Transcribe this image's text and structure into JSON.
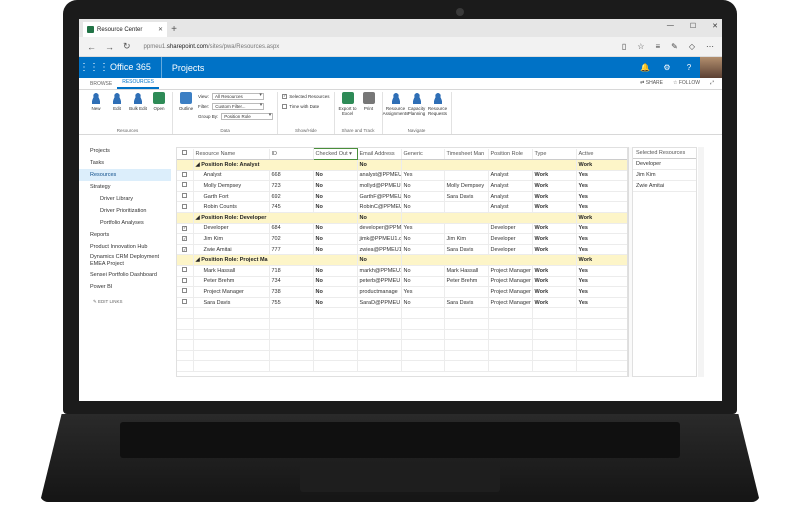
{
  "browser": {
    "tab_title": "Resource Center",
    "new_tab": "+",
    "url_prefix": "ppmeu1.",
    "url_host": "sharepoint.com",
    "url_path": "/sites/pwa/Resources.aspx",
    "win_min": "—",
    "win_max": "☐",
    "win_close": "✕",
    "back": "←",
    "forward": "→",
    "refresh": "↻",
    "close_tab": "✕"
  },
  "suite": {
    "brand": "Office 365",
    "app": "Projects",
    "waffle": "⋮⋮⋮"
  },
  "ribbon": {
    "tabs": [
      "BROWSE",
      "RESOURCES"
    ],
    "share": "SHARE",
    "follow": "FOLLOW",
    "groups": {
      "resources": "Resources",
      "data": "Data",
      "show_hide": "Show/Hide",
      "share_track": "Share and Track",
      "navigate": "Navigate"
    },
    "buttons": {
      "new": "New",
      "edit": "Edit",
      "bulk_edit": "Bulk Edit",
      "open": "Open",
      "outline": "Outline",
      "export": "Export to Excel",
      "print": "Print",
      "assignments": "Resource Assignments",
      "capacity": "Capacity Planning",
      "requests": "Resource Requests"
    },
    "view_label": "View:",
    "view_value": "All Resources",
    "filter_label": "Filter:",
    "filter_value": "Custom Filter...",
    "groupby_label": "Group By:",
    "groupby_value": "Position Role",
    "selected_resources": "Selected Resources",
    "time_with_date": "Time with Date"
  },
  "nav": {
    "items": [
      "Projects",
      "Tasks",
      "Resources",
      "Strategy",
      "Driver Library",
      "Driver Prioritization",
      "Portfolio Analyses",
      "Reports",
      "Product Innovation Hub",
      "Dynamics CRM Deployment EMEA Project",
      "Sensei Portfolio Dashboard",
      "Power BI"
    ],
    "edit_links": "EDIT LINKS"
  },
  "grid": {
    "columns": [
      "Resource Name",
      "ID",
      "Checked Out",
      "Email Address",
      "Generic",
      "Timesheet Man",
      "Position Role",
      "Type",
      "Active"
    ],
    "rows": [
      {
        "kind": "group",
        "name": "Position Role: Analyst",
        "checked_out": "No",
        "type": "Work",
        "active": "Yes"
      },
      {
        "kind": "row",
        "checked": false,
        "name": "Analyst",
        "id": "668",
        "checked_out": "No",
        "email": "analyst@PPMEU",
        "generic": "Yes",
        "timesheet": "",
        "role": "Analyst",
        "type": "Work",
        "active": "Yes"
      },
      {
        "kind": "row",
        "checked": false,
        "name": "Molly Dempsey",
        "id": "723",
        "checked_out": "No",
        "email": "mollyd@PPMEU",
        "generic": "No",
        "timesheet": "Molly Dempsey",
        "role": "Analyst",
        "type": "Work",
        "active": "Yes"
      },
      {
        "kind": "row",
        "checked": false,
        "name": "Garth Fort",
        "id": "692",
        "checked_out": "No",
        "email": "GarthF@PPMEU",
        "generic": "No",
        "timesheet": "Sara Davis",
        "role": "Analyst",
        "type": "Work",
        "active": "Yes"
      },
      {
        "kind": "row",
        "checked": false,
        "name": "Robin Counts",
        "id": "745",
        "checked_out": "No",
        "email": "RobinC@PPMEU",
        "generic": "No",
        "timesheet": "",
        "role": "Analyst",
        "type": "Work",
        "active": "Yes"
      },
      {
        "kind": "group",
        "name": "Position Role: Developer",
        "checked_out": "No",
        "type": "Work",
        "active": "Yes"
      },
      {
        "kind": "row",
        "checked": true,
        "name": "Developer",
        "id": "684",
        "checked_out": "No",
        "email": "developer@PPM",
        "generic": "Yes",
        "timesheet": "",
        "role": "Developer",
        "type": "Work",
        "active": "Yes"
      },
      {
        "kind": "row",
        "checked": true,
        "name": "Jim Kim",
        "id": "702",
        "checked_out": "No",
        "email": "jimk@PPMEU1.o",
        "generic": "No",
        "timesheet": "Jim Kim",
        "role": "Developer",
        "type": "Work",
        "active": "Yes"
      },
      {
        "kind": "row",
        "checked": true,
        "name": "Zwie Amitai",
        "id": "777",
        "checked_out": "No",
        "email": "zwiea@PPMEU1",
        "generic": "No",
        "timesheet": "Sara Davis",
        "role": "Developer",
        "type": "Work",
        "active": "Yes"
      },
      {
        "kind": "group",
        "name": "Position Role: Project Ma",
        "checked_out": "No",
        "type": "Work",
        "active": "Yes"
      },
      {
        "kind": "row",
        "checked": false,
        "name": "Mark Hassall",
        "id": "718",
        "checked_out": "No",
        "email": "markh@PPMEU1",
        "generic": "No",
        "timesheet": "Mark Hassall",
        "role": "Project Manager",
        "type": "Work",
        "active": "Yes"
      },
      {
        "kind": "row",
        "checked": false,
        "name": "Peter Brehm",
        "id": "734",
        "checked_out": "No",
        "email": "peterb@PPMEU",
        "generic": "No",
        "timesheet": "Peter Brehm",
        "role": "Project Manager",
        "type": "Work",
        "active": "Yes"
      },
      {
        "kind": "row",
        "checked": false,
        "name": "Project Manager",
        "id": "738",
        "checked_out": "No",
        "email": "productmanage",
        "generic": "Yes",
        "timesheet": "",
        "role": "Project Manager",
        "type": "Work",
        "active": "Yes"
      },
      {
        "kind": "row",
        "checked": false,
        "name": "Sara Davis",
        "id": "755",
        "checked_out": "No",
        "email": "SaraD@PPMEU",
        "generic": "No",
        "timesheet": "Sara Davis",
        "role": "Project Manager",
        "type": "Work",
        "active": "Yes"
      }
    ]
  },
  "selected_panel": {
    "header": "Selected Resources",
    "items": [
      "Developer",
      "Jim Kim",
      "Zwie Amitai"
    ]
  }
}
